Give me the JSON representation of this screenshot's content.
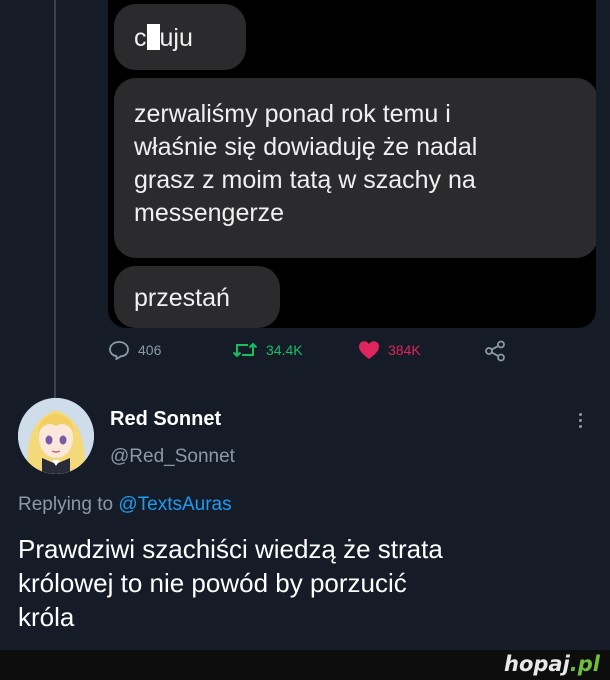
{
  "messages": {
    "first_prefix": "c",
    "first_suffix": "uju",
    "second": "zerwaliśmy ponad rok temu i\nwłaśnie się dowiaduję że nadal\ngrasz z moim tatą w szachy na\nmessengerze",
    "third": "przestań"
  },
  "stats": {
    "replies": "406",
    "retweets": "34.4K",
    "likes": "384K"
  },
  "colors": {
    "retweet": "#17bf63",
    "like": "#e0245e",
    "link": "#1d9bf0",
    "background": "#151c28"
  },
  "author": {
    "name": "Red Sonnet",
    "handle": "@Red_Sonnet"
  },
  "reply": {
    "prefix": "Replying to",
    "target": "@TextsAuras",
    "text": "Prawdziwi szachiści wiedzą że strata\nkrólowej to nie powód by porzucić\nkróla"
  },
  "watermark": {
    "main": "hopaj",
    "suffix": ".pl"
  }
}
